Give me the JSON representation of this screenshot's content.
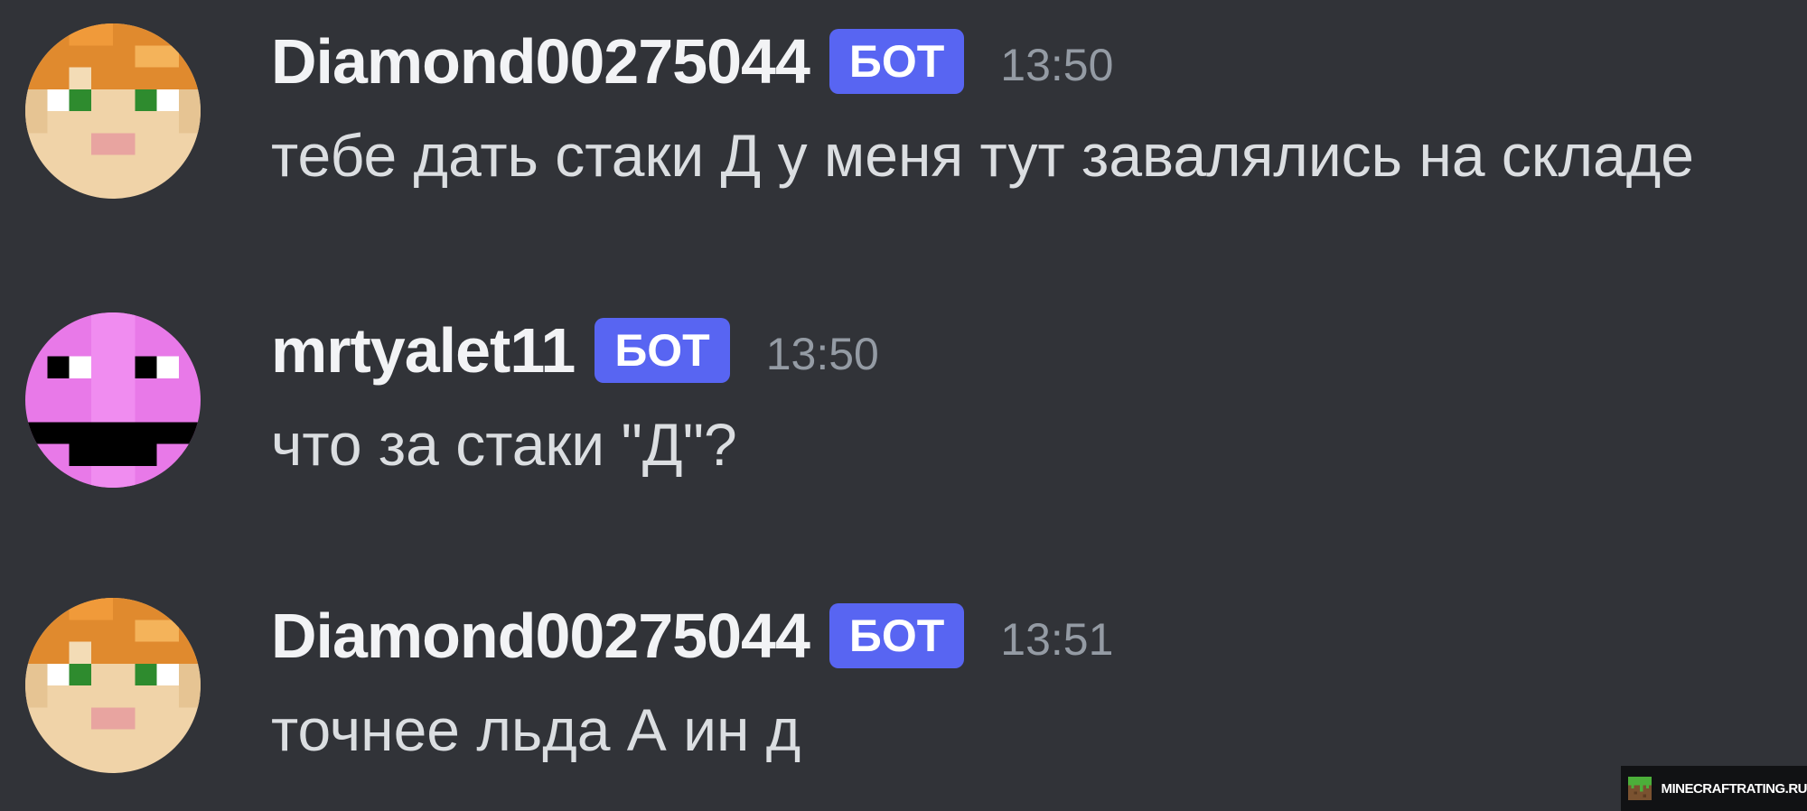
{
  "messages": [
    {
      "avatar_icon": "alex-minecraft-avatar-icon",
      "username": "Diamond00275044",
      "badge": "БОТ",
      "timestamp": "13:50",
      "text": "тебе дать стаки Д у меня тут завалялись на складе"
    },
    {
      "avatar_icon": "pink-creeper-face-avatar-icon",
      "username": "mrtyalet11",
      "badge": "БОТ",
      "timestamp": "13:50",
      "text": "что за стаки \"Д\"?"
    },
    {
      "avatar_icon": "alex-minecraft-avatar-icon",
      "username": "Diamond00275044",
      "badge": "БОТ",
      "timestamp": "13:51",
      "text": "точнее льда А ин д"
    }
  ],
  "watermark": {
    "text": "MINECRAFTRATING.RU",
    "icon": "grass-block-icon"
  },
  "colors": {
    "background": "#313338",
    "bot_badge": "#5865f2",
    "username": "#f2f3f5",
    "timestamp": "#949ba4",
    "message_text": "#dbdee1"
  }
}
